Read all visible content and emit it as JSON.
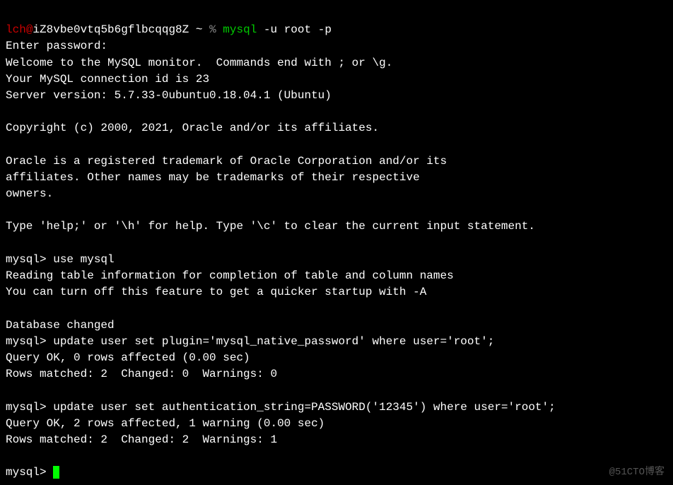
{
  "shell_prompt": {
    "user": "lch",
    "at": "@",
    "host": "iZ8vbe0vtq5b6gflbcqqg8Z",
    "path": " ~ ",
    "pct": "% ",
    "cmd_name": "mysql",
    "cmd_args": " -u root -p"
  },
  "lines": {
    "l1": "Enter password:",
    "l2": "Welcome to the MySQL monitor.  Commands end with ; or \\g.",
    "l3": "Your MySQL connection id is 23",
    "l4": "Server version: 5.7.33-0ubuntu0.18.04.1 (Ubuntu)",
    "l5": "",
    "l6": "Copyright (c) 2000, 2021, Oracle and/or its affiliates.",
    "l7": "",
    "l8": "Oracle is a registered trademark of Oracle Corporation and/or its",
    "l9": "affiliates. Other names may be trademarks of their respective",
    "l10": "owners.",
    "l11": "",
    "l12": "Type 'help;' or '\\h' for help. Type '\\c' to clear the current input statement.",
    "l13": "",
    "l14": "mysql> use mysql",
    "l15": "Reading table information for completion of table and column names",
    "l16": "You can turn off this feature to get a quicker startup with -A",
    "l17": "",
    "l18": "Database changed",
    "l19": "mysql> update user set plugin='mysql_native_password' where user='root';",
    "l20": "Query OK, 0 rows affected (0.00 sec)",
    "l21": "Rows matched: 2  Changed: 0  Warnings: 0",
    "l22": "",
    "l23": "mysql> update user set authentication_string=PASSWORD('12345') where user='root';",
    "l24": "Query OK, 2 rows affected, 1 warning (0.00 sec)",
    "l25": "Rows matched: 2  Changed: 2  Warnings: 1",
    "l26": "",
    "l27": "mysql> "
  },
  "watermark": "@51CTO博客"
}
